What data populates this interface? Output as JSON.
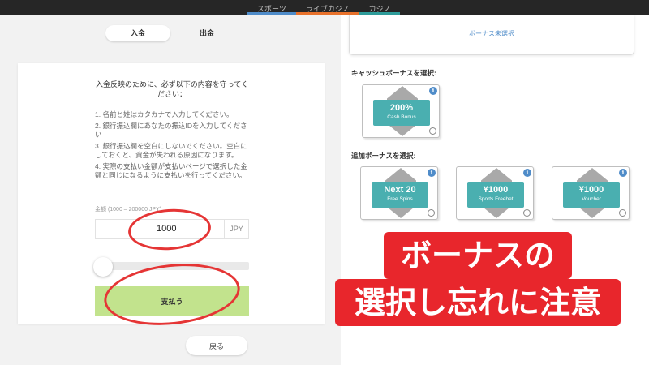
{
  "nav": {
    "tabs": [
      {
        "label": "スポーツ",
        "color": "#4f8cc9"
      },
      {
        "label": "ライブカジノ",
        "color": "#e8722c"
      },
      {
        "label": "カジノ",
        "color": "#2f9e9c",
        "active": true
      }
    ]
  },
  "payment": {
    "tab_deposit": "入金",
    "tab_withdraw": "出金",
    "notice_title": "入金反映のために、必ず以下の内容を守ってください：",
    "rules": [
      "1. 名前と姓はカタカナで入力してください。",
      "2. 銀行振込欄にあなたの振込IDを入力してください",
      "3. 銀行振込欄を空白にしないでください。空白にしておくと、資金が失われる原因になります。",
      "4. 実際の支払い金額が支払いページで選択した金額と同じになるように支払いを行ってください。"
    ],
    "amount_label": "金額 (1000 – 200000 JPY)",
    "amount_value": "1000",
    "currency": "JPY",
    "pay_label": "支払う",
    "back_label": "戻る",
    "slider_level": 0
  },
  "bonus": {
    "none_selected": "ボーナス未選択",
    "cash_label": "キャッシュボーナスを選択:",
    "extra_label": "追加ボーナスを選択:",
    "cash": [
      {
        "big": "200%",
        "small": "Cash Bonus"
      }
    ],
    "extra": [
      {
        "big": "Next 20",
        "small": "Free Spins"
      },
      {
        "big": "¥1000",
        "small": "Sports Freebet"
      },
      {
        "big": "¥1000",
        "small": "Voucher"
      }
    ],
    "info_glyph": "i"
  },
  "overlay": {
    "line1": "ボーナスの",
    "line2": "選択し忘れに注意"
  },
  "colors": {
    "accent_teal": "#4aafb0",
    "pay_green": "#c2e38d",
    "banner_red": "#e8262c",
    "link_blue": "#4f8cc9"
  }
}
